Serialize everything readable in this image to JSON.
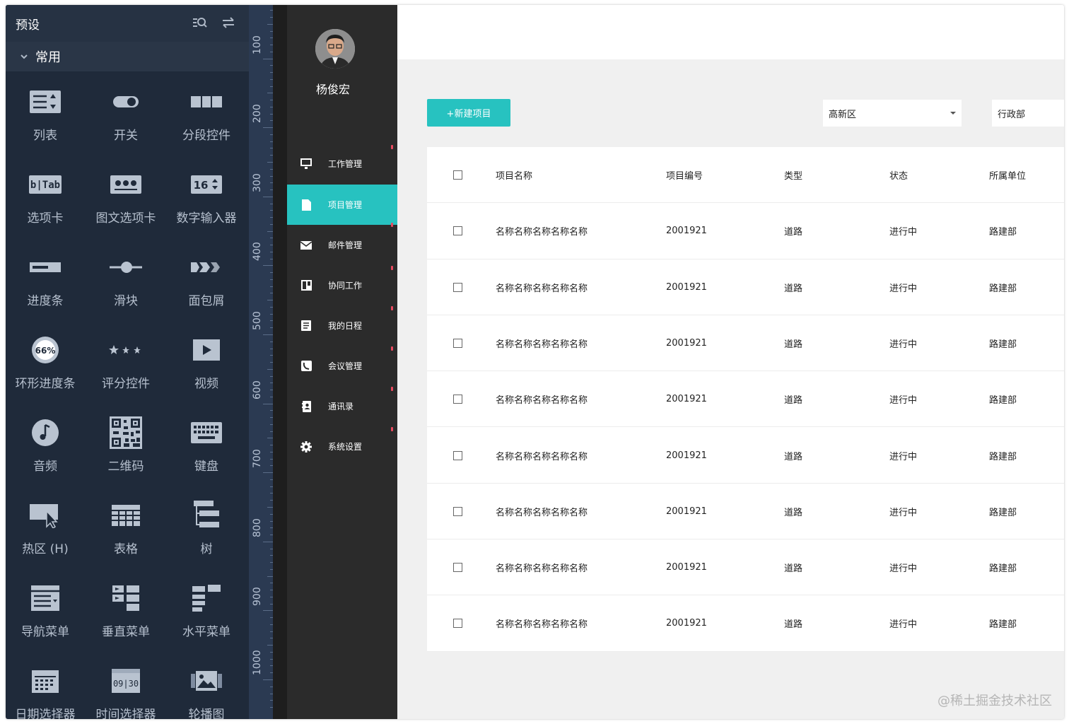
{
  "panel": {
    "title": "预设",
    "group": "常用",
    "items": [
      {
        "label": "列表",
        "icon": "list-icon"
      },
      {
        "label": "开关",
        "icon": "switch-icon"
      },
      {
        "label": "分段控件",
        "icon": "segmented-control-icon"
      },
      {
        "label": "选项卡",
        "icon": "tab-icon"
      },
      {
        "label": "图文选项卡",
        "icon": "image-text-tab-icon"
      },
      {
        "label": "数字输入器",
        "icon": "number-input-icon"
      },
      {
        "label": "进度条",
        "icon": "progress-bar-icon"
      },
      {
        "label": "滑块",
        "icon": "slider-icon"
      },
      {
        "label": "面包屑",
        "icon": "breadcrumb-icon"
      },
      {
        "label": "环形进度条",
        "icon": "ring-progress-icon"
      },
      {
        "label": "评分控件",
        "icon": "rating-icon"
      },
      {
        "label": "视频",
        "icon": "video-icon"
      },
      {
        "label": "音频",
        "icon": "audio-icon"
      },
      {
        "label": "二维码",
        "icon": "qrcode-icon"
      },
      {
        "label": "键盘",
        "icon": "keyboard-icon"
      },
      {
        "label": "热区 (H)",
        "icon": "hotspot-icon"
      },
      {
        "label": "表格",
        "icon": "table-icon"
      },
      {
        "label": "树",
        "icon": "tree-icon"
      },
      {
        "label": "导航菜单",
        "icon": "nav-menu-icon"
      },
      {
        "label": "垂直菜单",
        "icon": "vertical-menu-icon"
      },
      {
        "label": "水平菜单",
        "icon": "horizontal-menu-icon"
      },
      {
        "label": "日期选择器",
        "icon": "date-picker-icon"
      },
      {
        "label": "时间选择器",
        "icon": "time-picker-icon"
      },
      {
        "label": "轮播图",
        "icon": "carousel-icon"
      }
    ],
    "icon_text": {
      "tab": "b|Tab",
      "number": "16",
      "ring": "66%",
      "time": "09|30"
    }
  },
  "ruler": {
    "labels": [
      "100",
      "200",
      "300",
      "400",
      "500",
      "600",
      "700",
      "800",
      "900",
      "1000"
    ]
  },
  "nav": {
    "user_name": "杨俊宏",
    "items": [
      {
        "label": "工作管理",
        "icon": "monitor-icon",
        "active": false
      },
      {
        "label": "项目管理",
        "icon": "document-icon",
        "active": true
      },
      {
        "label": "邮件管理",
        "icon": "mail-icon",
        "active": false
      },
      {
        "label": "协同工作",
        "icon": "collab-icon",
        "active": false
      },
      {
        "label": "我的日程",
        "icon": "schedule-icon",
        "active": false
      },
      {
        "label": "会议管理",
        "icon": "meeting-icon",
        "active": false
      },
      {
        "label": "通讯录",
        "icon": "contacts-icon",
        "active": false
      },
      {
        "label": "系统设置",
        "icon": "gear-icon",
        "active": false
      }
    ]
  },
  "toolbar": {
    "new_button": "+新建项目",
    "district_select": "高新区",
    "department_select": "行政部"
  },
  "table": {
    "headers": [
      "项目名称",
      "项目编号",
      "类型",
      "状态",
      "所属单位"
    ],
    "rows": [
      [
        "名称名称名称名称名称",
        "2001921",
        "道路",
        "进行中",
        "路建部"
      ],
      [
        "名称名称名称名称名称",
        "2001921",
        "道路",
        "进行中",
        "路建部"
      ],
      [
        "名称名称名称名称名称",
        "2001921",
        "道路",
        "进行中",
        "路建部"
      ],
      [
        "名称名称名称名称名称",
        "2001921",
        "道路",
        "进行中",
        "路建部"
      ],
      [
        "名称名称名称名称名称",
        "2001921",
        "道路",
        "进行中",
        "路建部"
      ],
      [
        "名称名称名称名称名称",
        "2001921",
        "道路",
        "进行中",
        "路建部"
      ],
      [
        "名称名称名称名称名称",
        "2001921",
        "道路",
        "进行中",
        "路建部"
      ],
      [
        "名称名称名称名称名称",
        "2001921",
        "道路",
        "进行中",
        "路建部"
      ]
    ]
  },
  "watermark": "@稀土掘金技术社区",
  "colors": {
    "accent": "#27c2c0",
    "panel_bg": "#1f2a3a",
    "nav_bg": "#2b2b2b",
    "nav_dot": "#e84a5f"
  }
}
